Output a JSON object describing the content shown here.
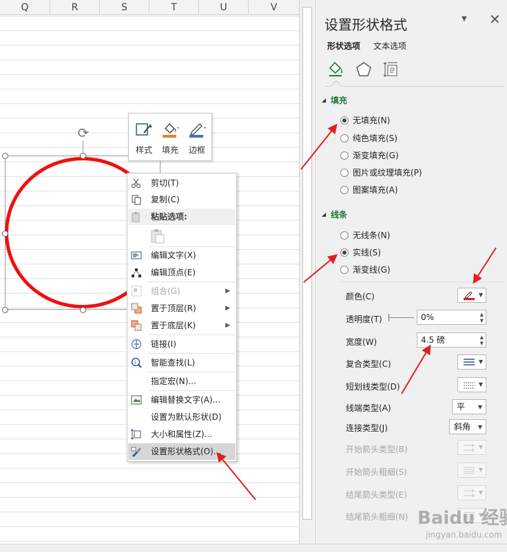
{
  "sheet": {
    "columns": [
      "Q",
      "R",
      "S",
      "T",
      "U",
      "V"
    ]
  },
  "mini_toolbar": {
    "buttons": [
      {
        "label": "样式",
        "icon": "shape-style-icon"
      },
      {
        "label": "填充",
        "icon": "fill-bucket-icon"
      },
      {
        "label": "边框",
        "icon": "outline-pen-icon"
      }
    ]
  },
  "context_menu": {
    "items": [
      {
        "label": "剪切(T)",
        "icon": "scissors-icon"
      },
      {
        "label": "复制(C)",
        "icon": "copy-icon"
      },
      {
        "label": "粘贴选项:",
        "icon": "paste-icon"
      },
      {
        "label": "编辑文字(X)",
        "icon": "edit-text-icon"
      },
      {
        "label": "编辑顶点(E)",
        "icon": "edit-points-icon"
      },
      {
        "label": "组合(G)",
        "icon": "group-icon"
      },
      {
        "label": "置于顶层(R)",
        "icon": "bring-front-icon"
      },
      {
        "label": "置于底层(K)",
        "icon": "send-back-icon"
      },
      {
        "label": "链接(I)",
        "icon": "link-icon"
      },
      {
        "label": "智能查找(L)",
        "icon": "smart-lookup-icon"
      },
      {
        "label": "指定宏(N)...",
        "icon": ""
      },
      {
        "label": "编辑替换文字(A)...",
        "icon": "alt-text-icon"
      },
      {
        "label": "设置为默认形状(D)",
        "icon": ""
      },
      {
        "label": "大小和属性(Z)...",
        "icon": "size-props-icon"
      },
      {
        "label": "设置形状格式(O)...",
        "icon": "format-shape-icon"
      }
    ]
  },
  "panel": {
    "title": "设置形状格式",
    "tabs": [
      "形状选项",
      "文本选项"
    ],
    "fill": {
      "heading": "填充",
      "options": [
        "无填充(N)",
        "纯色填充(S)",
        "渐变填充(G)",
        "图片或纹理填充(P)",
        "图案填充(A)"
      ],
      "selected": "无填充(N)"
    },
    "line": {
      "heading": "线条",
      "options": [
        "无线条(N)",
        "实线(S)",
        "渐变线(G)"
      ],
      "selected": "实线(S)"
    },
    "props": {
      "color_label": "颜色(C)",
      "color_value": "#e81123",
      "transparency_label": "透明度(T)",
      "transparency_value": "0%",
      "width_label": "宽度(W)",
      "width_value": "4.5 磅",
      "compound_label": "复合类型(C)",
      "dash_label": "短划线类型(D)",
      "cap_label": "线端类型(A)",
      "cap_value": "平",
      "join_label": "连接类型(J)",
      "join_value": "斜角",
      "begin_arrow_type_label": "开始箭头类型(B)",
      "begin_arrow_size_label": "开始箭头粗细(S)",
      "end_arrow_type_label": "结尾箭头类型(E)",
      "end_arrow_size_label": "结尾箭头粗细(N)"
    }
  },
  "watermark": {
    "logo": "Baidu 经验",
    "url": "jingyan.baidu.com"
  },
  "colors": {
    "accent_green": "#1e7a3c",
    "shape_red": "#ee1111",
    "annotation_red": "#e02020"
  }
}
